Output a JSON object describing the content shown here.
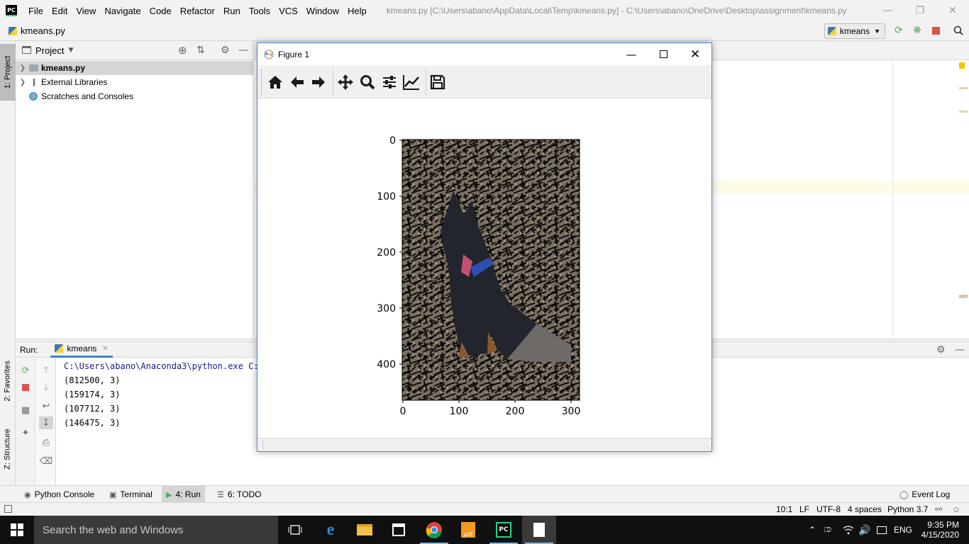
{
  "menu": {
    "items": [
      "File",
      "Edit",
      "View",
      "Navigate",
      "Code",
      "Refactor",
      "Run",
      "Tools",
      "VCS",
      "Window",
      "Help"
    ],
    "window_title": "kmeans.py [C:\\Users\\abano\\AppData\\Local\\Temp\\kmeans.py] - C:\\Users\\abano\\OneDrive\\Desktop\\assignment\\kmeans.py",
    "app_logo_text": "PC"
  },
  "nav": {
    "file": "kmeans.py",
    "run_config": "kmeans"
  },
  "side_tabs": {
    "project": "1: Project",
    "favorites": "2: Favorites",
    "structure": "Z: Structure"
  },
  "project": {
    "title": "Project",
    "tree": [
      {
        "label": "kmeans.py",
        "bold": true
      },
      {
        "label": "External Libraries"
      },
      {
        "label": "Scratches and Consoles"
      }
    ]
  },
  "figure": {
    "title": "Figure 1",
    "toolbar": [
      "home-icon",
      "back-arrow-icon",
      "forward-arrow-icon",
      "pan-icon",
      "zoom-icon",
      "subplots-icon",
      "edit-axes-icon",
      "save-icon"
    ],
    "x_ticks": [
      "0",
      "100",
      "200",
      "300"
    ],
    "y_ticks": [
      "0",
      "100",
      "200",
      "300",
      "400"
    ]
  },
  "run": {
    "label": "Run:",
    "tab": "kmeans",
    "output": [
      "C:\\Users\\abano\\Anaconda3\\python.exe C:/",
      "(812500, 3)",
      "(159174, 3)",
      "(107712, 3)",
      "(146475, 3)"
    ]
  },
  "bottom_tabs": {
    "python_console": "Python Console",
    "terminal": "Terminal",
    "run": "4: Run",
    "todo": "6: TODO",
    "event_log": "Event Log"
  },
  "status": {
    "position": "10:1",
    "line_sep": "LF",
    "encoding": "UTF-8",
    "indent": "4 spaces",
    "interpreter": "Python 3.7"
  },
  "taskbar": {
    "search_placeholder": "Search the web and Windows",
    "language": "ENG",
    "time": "9:35 PM",
    "date": "4/15/2020"
  },
  "colors": {
    "accent": "#4083c9",
    "stop_red": "#d9534f",
    "run_green": "#59a869"
  }
}
